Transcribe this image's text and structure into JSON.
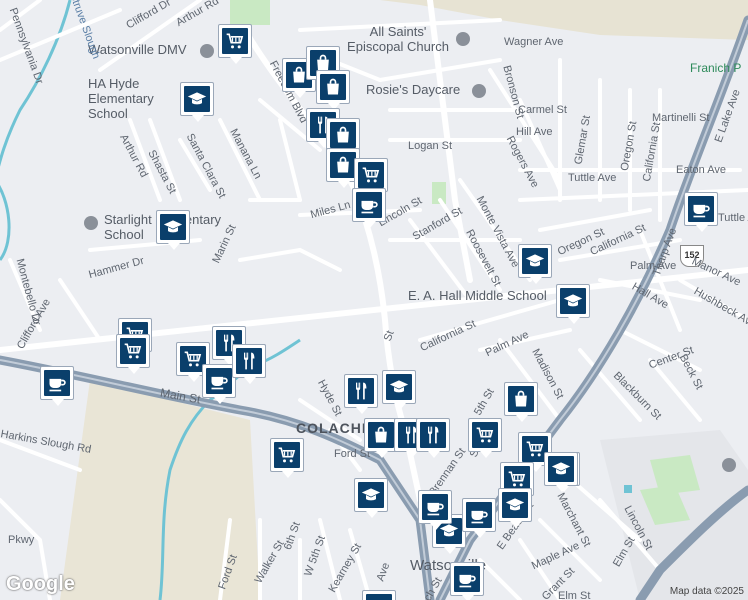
{
  "map": {
    "attribution": "Map data ©2025",
    "logo": "Google",
    "highway_shield": "152"
  },
  "places": [
    {
      "name": "Watsonville DMV",
      "kind": "poi"
    },
    {
      "name": "HA Hyde Elementary School",
      "kind": "poi"
    },
    {
      "name": "All Saints' Episcopal Church",
      "kind": "poi"
    },
    {
      "name": "Rosie's Daycare",
      "kind": "poi"
    },
    {
      "name": "Starlight Elementary School",
      "kind": "poi"
    },
    {
      "name": "E. A. Hall Middle School",
      "kind": "poi"
    },
    {
      "name": "COLACHE",
      "kind": "area"
    },
    {
      "name": "Watsonville",
      "kind": "city"
    },
    {
      "name": "Franich P",
      "kind": "park"
    },
    {
      "name": "Struve Slough",
      "kind": "water"
    }
  ],
  "streets": [
    "Clifford Dr",
    "Arthur Rd",
    "Freedom Blvd",
    "Wagner Ave",
    "Bronson St",
    "Carmel St",
    "Hill Ave",
    "Glemar St",
    "Martinelli St",
    "Oregon St",
    "California St",
    "Eaton Ave",
    "Tuttle Ave",
    "Logan St",
    "Rogers Ave",
    "Monte Vista Ave",
    "Stanford St",
    "Lincoln St",
    "Miles Ln",
    "Roosevelt St",
    "Manana Ln",
    "Santa Clara St",
    "Shasta St",
    "Arthur Rd",
    "Marin St",
    "Hammer Dr",
    "Montebello Dr",
    "Clifford Ave",
    "Main St",
    "Hyde St",
    "Ford St",
    "California St",
    "Palm Ave",
    "Madison St",
    "Hall Ave",
    "Manor Ave",
    "Hushbeck Ave",
    "Tharp Ave",
    "Center St",
    "Beck St",
    "Blackburn St",
    "Marchant St",
    "Lincoln St",
    "Elm St",
    "Maple Ave",
    "Grant St",
    "5th St",
    "6th St",
    "W 5th St",
    "Walker St",
    "Kearney St",
    "Pennsylvania Dr",
    "Harkins Slough Rd",
    "Pkwy",
    "E Lake Ave",
    "E Beach St",
    "Tuttle Ave",
    "Palm Ave",
    "Oregon St",
    "California St",
    "Ave",
    "Elm St",
    "St",
    "St",
    "Brennan St",
    "Ford St",
    "ach St"
  ],
  "markers": [
    {
      "icon": "cart"
    },
    {
      "icon": "bag"
    },
    {
      "icon": "bag"
    },
    {
      "icon": "bag"
    },
    {
      "icon": "school"
    },
    {
      "icon": "fork"
    },
    {
      "icon": "bag"
    },
    {
      "icon": "bag"
    },
    {
      "icon": "cart"
    },
    {
      "icon": "cup"
    },
    {
      "icon": "school"
    },
    {
      "icon": "school"
    },
    {
      "icon": "school"
    },
    {
      "icon": "cup"
    },
    {
      "icon": "cart"
    },
    {
      "icon": "cart"
    },
    {
      "icon": "fork"
    },
    {
      "icon": "fork"
    },
    {
      "icon": "cart"
    },
    {
      "icon": "cup"
    },
    {
      "icon": "cup"
    },
    {
      "icon": "fork"
    },
    {
      "icon": "school"
    },
    {
      "icon": "fork"
    },
    {
      "icon": "bag"
    },
    {
      "icon": "bag"
    },
    {
      "icon": "fork"
    },
    {
      "icon": "fork"
    },
    {
      "icon": "cart"
    },
    {
      "icon": "cart"
    },
    {
      "icon": "cart"
    },
    {
      "icon": "cart"
    },
    {
      "icon": "school"
    },
    {
      "icon": "school"
    },
    {
      "icon": "cart"
    },
    {
      "icon": "school"
    },
    {
      "icon": "cup"
    },
    {
      "icon": "cup"
    },
    {
      "icon": "school"
    },
    {
      "icon": "cup"
    },
    {
      "icon": "cup"
    }
  ],
  "colors": {
    "marker_fill": "#0a3f6b",
    "road": "#ffffff",
    "highway": "#8a9cb0",
    "water": "#6fc3d4",
    "park": "#c9e9c3",
    "land": "#eceef2"
  }
}
